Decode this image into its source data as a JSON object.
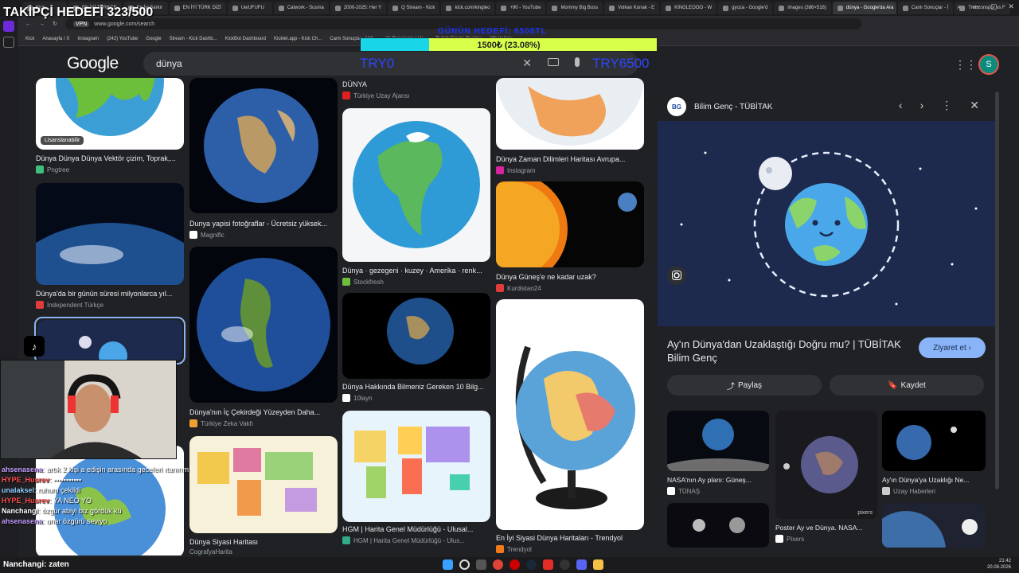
{
  "overlay": {
    "follower_goal": "TAKİPÇİ HEDEFİ 323/500",
    "progress_header": "GÜNÜN HEDEFİ: 6500TL",
    "progress_label": "1500₺ (23.08%)",
    "progress_fraction": 0.2308,
    "try_left": "TRY0",
    "try_right": "TRY6500"
  },
  "browser": {
    "tabs": [
      {
        "label": "Kick"
      },
      {
        "label": "EN İYİ TÜRKÇE"
      },
      {
        "label": "En İyi Şarkıl"
      },
      {
        "label": "EN İYİ TÜRK DİZİ"
      },
      {
        "label": "UwUFUFU"
      },
      {
        "label": "Catwork - Susma"
      },
      {
        "label": "2000-2025: Her Y"
      },
      {
        "label": "Q Stream - Kick"
      },
      {
        "label": "kick.com/kingleo"
      },
      {
        "label": "+90 - YouTube"
      },
      {
        "label": "Mommy Big Boss"
      },
      {
        "label": "Volkan Konak - E"
      },
      {
        "label": "KINGLEOOO - W"
      },
      {
        "label": "gyoza - Google'd"
      },
      {
        "label": "images (386×518)"
      },
      {
        "label": "dünya - Google'da Ara",
        "active": true
      },
      {
        "label": "Canlı Sonuçlar - İ"
      },
      {
        "label": "Trabzonspor vs F"
      }
    ],
    "url": "www.google.com/search",
    "bookmarks": [
      "Kick",
      "Anasayfa / X",
      "Instagram",
      "(242) YouTube",
      "Google",
      "Stream - Kick Dashb...",
      "KickBot Dashboard",
      "Kicklet.app - Kick Ch...",
      "Canlı Sonuçlar - İddi...",
      "(1) Projelerim | He...",
      "Twitch Emote Resizer",
      "WhatsApp"
    ]
  },
  "google": {
    "logo": "Google",
    "query": "dünya",
    "avatar_letter": "S"
  },
  "results": {
    "col1": [
      {
        "title": "Dünya Dünya Dünya Vektör çizim, Toprak,...",
        "source": "Pngtree",
        "badge": "Lisanslanabilir"
      },
      {
        "title": "Dünya'da bir günün süresi milyonlarca yıl...",
        "source": "Independent Türkçe"
      }
    ],
    "col2": [
      {
        "title": "Dunya yapisi fotoğraflar - Ücretsiz yüksek...",
        "source": "Magnific"
      },
      {
        "title": "Dünya'nın İç Çekirdeği Yüzeyden Daha...",
        "source": "Türkiye Zeka Vakfı"
      },
      {
        "title": "Dünya Siyasi Haritası",
        "source": "CografyaHarita"
      }
    ],
    "col3": [
      {
        "title": "DÜNYA",
        "source": "Türkiye Uzay Ajansı"
      },
      {
        "title": "Dünya · gezegeni · kuzey · Amerika · renk...",
        "source": "Stockfresh"
      },
      {
        "title": "Dünya Hakkında Bilmeniz Gereken 10 Bilg...",
        "source": "10layn"
      },
      {
        "title": "HGM | Harita Genel Müdürlüğü - Ulusal...",
        "source": "HGM | Harita Genel Müdürlüğü - Ulus..."
      }
    ],
    "col4": [
      {
        "title": "Dünya Zaman Dilimleri Haritası Avrupa...",
        "source": "Instagram"
      },
      {
        "title": "Dünya Güneş'e ne kadar uzak?",
        "source": "Kurdistan24"
      },
      {
        "title": "En İyi Siyasi Dünya Haritaları - Trendyol",
        "source": "Trendyol"
      }
    ]
  },
  "panel": {
    "source": "Bilim Genç - TÜBİTAK",
    "logo_text": "BG",
    "title": "Ay'ın Dünya'dan Uzaklaştığı Doğru mu? | TÜBİTAK Bilim Genç",
    "visit": "Ziyaret et",
    "share": "Paylaş",
    "save": "Kaydet",
    "related": [
      {
        "title": "NASA'nın Ay planı: Güneş...",
        "source": "TÜNAŞ"
      },
      {
        "title": "Poster Ay ve Dünya. NASA...",
        "source": "Pixers",
        "badge": "pixers"
      },
      {
        "title": "Ay'ın Dünya'ya Uzaklığı Ne...",
        "source": "Uzay Haberleri"
      }
    ]
  },
  "chat": [
    {
      "user": "ahsenasena",
      "user_color": "#c59cff",
      "text": "artık 2 kişi a edişin arasında geceleri ıtanırım"
    },
    {
      "user": "HYPE_Husrev",
      "user_color": "#ff4d4d",
      "text": "▪▪▪▪▪▪▪▪▪▪▪"
    },
    {
      "user": "unalaksel",
      "user_color": "#8fd3ff",
      "text": "ruhum çekildi"
    },
    {
      "user": "HYPE_Husrev",
      "user_color": "#ff4d4d",
      "text": "YA NEO YO"
    },
    {
      "user": "Nanchangi",
      "user_color": "#ffffff",
      "text": "özgür abiyi biz gördük kü"
    },
    {
      "user": "ahsenasena",
      "user_color": "#c59cff",
      "text": "unar özgürü seviyo"
    }
  ],
  "taskbar": {
    "now_line": "Nanchangi: zaten",
    "time": "21:42",
    "date": "20.08.2026"
  }
}
